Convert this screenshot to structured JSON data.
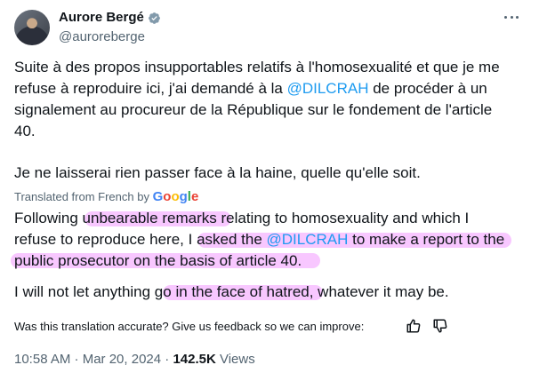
{
  "author": {
    "name": "Aurore Bergé",
    "handle": "@auroreberge"
  },
  "tweet": {
    "original_line_1_a": "Suite à des propos insupportables relatifs à l'homosexualité et que je me",
    "original_line_2_a": "refuse à reproduire ici, j'ai demandé à la ",
    "mention": "@DILCRAH",
    "original_line_2_b": " de procéder à un",
    "original_line_3": "signalement au procureur de la République sur le fondement de l'article",
    "original_line_4": "40.",
    "original_paragraph_2": "Je ne laisserai rien passer face à la haine, quelle qu'elle soit."
  },
  "translation": {
    "label": "Translated from French by",
    "google": [
      "G",
      "o",
      "o",
      "g",
      "l",
      "e"
    ],
    "line_1_a": "Following ",
    "line_1_b": "unbearable remarks",
    "line_1_c": " relating to homosexuality and which I",
    "line_2_a": "refuse to reproduce here, I ",
    "line_2_b": "asked the ",
    "line_2_mention": "@DILCRAH",
    "line_2_c": " to make a report to the",
    "line_3": "public prosecutor on the basis of article 40.",
    "line_4_a": "I will not let anything go ",
    "line_4_b": "in the face of hatred",
    "line_4_c": ", whatever it may be.",
    "highlight_color": "#f6b4ff"
  },
  "feedback": {
    "text": "Was this translation accurate? Give us feedback so we can improve:",
    "thumbs_up_icon": "thumbs-up-icon",
    "thumbs_down_icon": "thumbs-down-icon"
  },
  "meta": {
    "time": "10:58 AM · Mar 20, 2024 · ",
    "views_count": "142.5K",
    "views_label": " Views"
  },
  "colors": {
    "accent": "#1d9bf0",
    "text": "#0f1419",
    "muted": "#536471"
  }
}
